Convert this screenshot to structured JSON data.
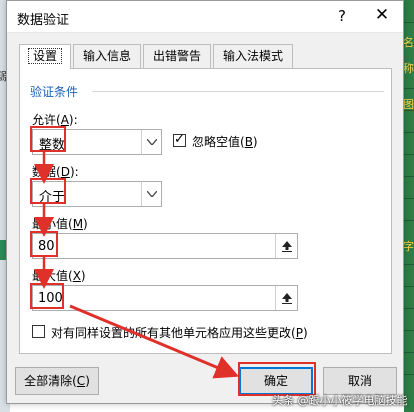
{
  "dialog": {
    "title": "数据验证",
    "help": "?",
    "close": "✕"
  },
  "tabs": [
    {
      "label": "设置",
      "active": true
    },
    {
      "label": "输入信息",
      "active": false
    },
    {
      "label": "出错警告",
      "active": false
    },
    {
      "label": "输入法模式",
      "active": false
    }
  ],
  "validation": {
    "group_label": "验证条件",
    "allow": {
      "label_text": "允许(",
      "label_key": "A",
      "label_end": "):",
      "value": "整数"
    },
    "ignore_blank": {
      "label_text": "忽略空值(",
      "label_key": "B",
      "label_end": ")",
      "checked": true,
      "mark": "✓"
    },
    "data": {
      "label_text": "数据(",
      "label_key": "D",
      "label_end": "):",
      "value": "介于"
    },
    "minimum": {
      "label_text": "最小值(",
      "label_key": "M",
      "label_end": ")",
      "value": "80"
    },
    "maximum": {
      "label_text": "最大值(",
      "label_key": "X",
      "label_end": ")",
      "value": "100"
    },
    "apply_all": {
      "label_text": "对有同样设置的所有其他单元格应用这些更改(",
      "label_key": "P",
      "label_end": ")",
      "checked": false
    }
  },
  "buttons": {
    "clear_all_text": "全部清除(",
    "clear_all_key": "C",
    "clear_all_end": ")",
    "ok": "确定",
    "cancel": "取消"
  },
  "background": {
    "left_fragment": "源",
    "right_fragments": [
      "名",
      "称",
      "图",
      "字"
    ]
  },
  "watermark": "头条 @跟小小筱学电脑技能",
  "colors": {
    "annotation_red": "#e0302a",
    "accent_blue": "#0078d7",
    "group_label_blue": "#1a5fb4"
  },
  "icons": {
    "dropdown": "chevron-down-icon",
    "range_picker": "collapse-arrow-icon",
    "check": "checkmark-icon"
  }
}
